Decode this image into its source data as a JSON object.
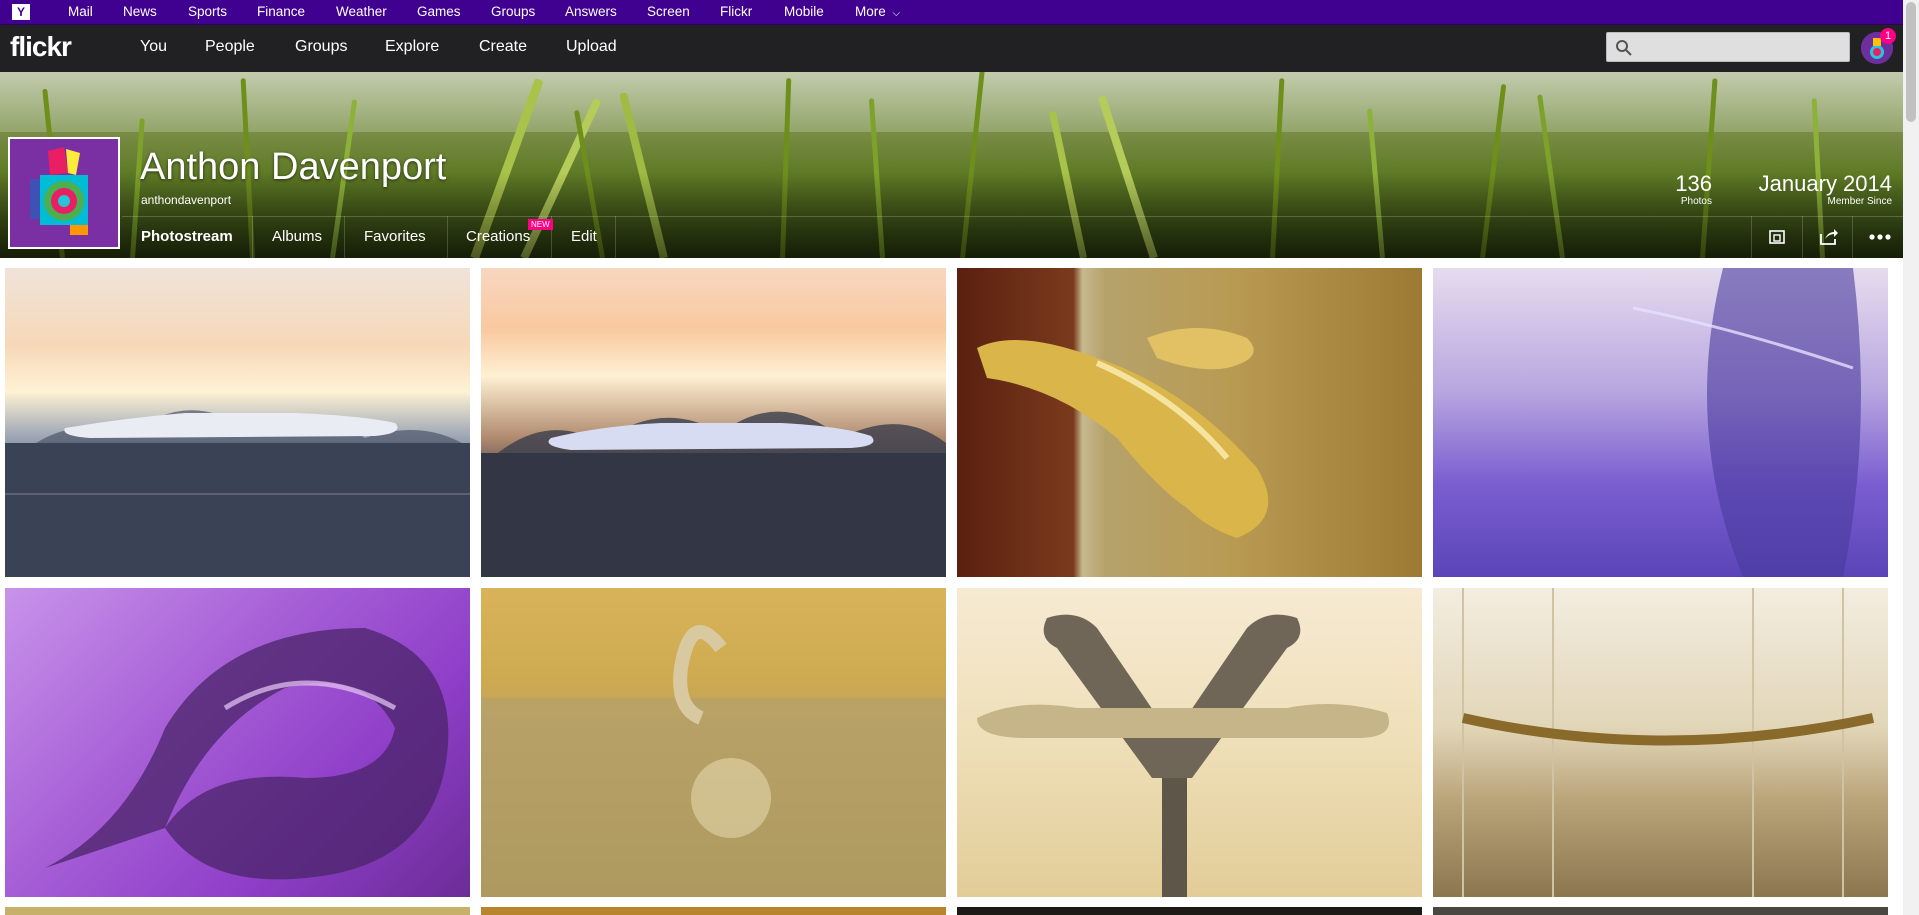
{
  "yahoo_bar": {
    "logo": "Y",
    "links": [
      "Mail",
      "News",
      "Sports",
      "Finance",
      "Weather",
      "Games",
      "Groups",
      "Answers",
      "Screen",
      "Flickr",
      "Mobile",
      "More"
    ]
  },
  "flickr_nav": {
    "logo": "flickr",
    "items": [
      "You",
      "People",
      "Groups",
      "Explore",
      "Create",
      "Upload"
    ],
    "search_placeholder": "",
    "notification_count": "1"
  },
  "profile": {
    "name": "Anthon Davenport",
    "username": "anthondavenport",
    "photos_count": "136",
    "photos_label": "Photos",
    "member_since": "January 2014",
    "member_since_label": "Member Since"
  },
  "tabs": [
    {
      "label": "Photostream",
      "active": true
    },
    {
      "label": "Albums",
      "active": false
    },
    {
      "label": "Favorites",
      "active": false
    },
    {
      "label": "Creations",
      "active": false,
      "badge": "NEW"
    },
    {
      "label": "Edit",
      "active": false
    }
  ],
  "controls": [
    "slideshow-icon",
    "share-icon",
    "more-icon"
  ],
  "photos": [
    {
      "name": "photo-sunset-1",
      "colors": [
        "#f4d6c4",
        "#fff3df",
        "#3d4a5d",
        "#5e6676"
      ]
    },
    {
      "name": "photo-sunset-2",
      "colors": [
        "#f7c9a2",
        "#fff0d8",
        "#3b3f4c",
        "#4a4e5e"
      ]
    },
    {
      "name": "photo-gold-clip",
      "colors": [
        "#6b2b12",
        "#b48f3f",
        "#cfb068",
        "#8a6a27"
      ]
    },
    {
      "name": "photo-purple-glass",
      "colors": [
        "#d6cbe9",
        "#8a72d6",
        "#5b43b8",
        "#bba9e6"
      ]
    },
    {
      "name": "photo-purple-ring",
      "colors": [
        "#b97fe0",
        "#8a3ec6",
        "#5b2a8e",
        "#c98ee8"
      ]
    },
    {
      "name": "photo-gold-hook",
      "colors": [
        "#d1ad4e",
        "#c7a24a",
        "#9b7d2c",
        "#e5c77e"
      ]
    },
    {
      "name": "photo-coat-hook",
      "colors": [
        "#f5e6c1",
        "#e8d6a8",
        "#cbb27a",
        "#f2e2bb"
      ]
    },
    {
      "name": "photo-lamp-chain",
      "colors": [
        "#f1eadb",
        "#d7c8a4",
        "#a38d5f",
        "#c6b38c"
      ]
    }
  ]
}
